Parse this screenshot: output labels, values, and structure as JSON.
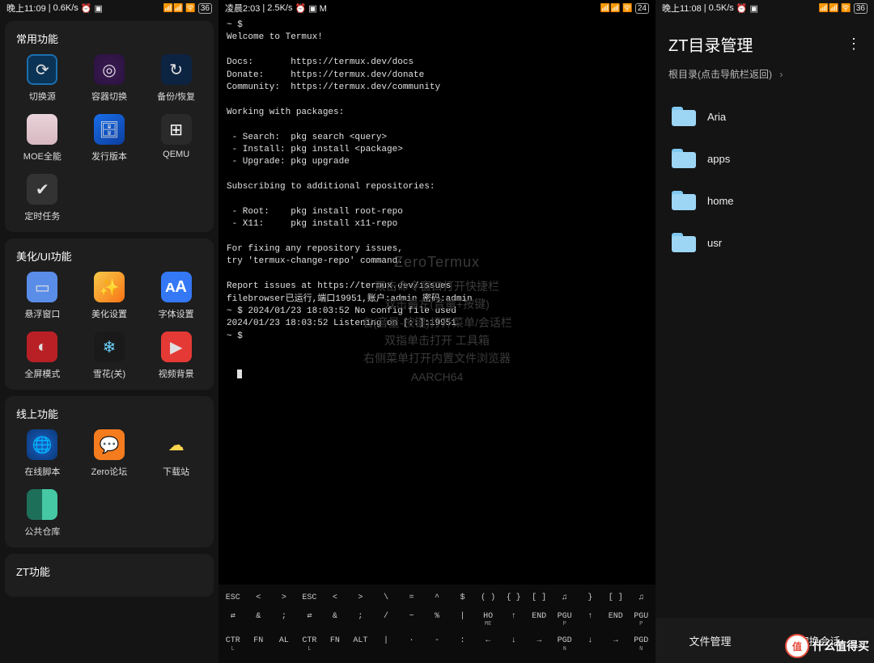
{
  "statusbars": {
    "left": {
      "time": "晚上11:09",
      "speed": "0.6K/s",
      "icons": "⏰ ▣",
      "net": "📶📶 🛜",
      "battery": "36"
    },
    "mid": {
      "time": "凌晨2:03",
      "speed": "2.5K/s",
      "icons": "⏰ ▣ M",
      "net": "📶📶 🛜",
      "battery": "24"
    },
    "right": {
      "time": "晚上11:08",
      "speed": "0.5K/s",
      "icons": "⏰ ▣",
      "net": "📶📶 🛜",
      "battery": "36"
    }
  },
  "sidebar": {
    "sections": [
      {
        "title": "常用功能",
        "items": [
          {
            "name": "switch-source",
            "label": "切换源",
            "bg": "bg-globe",
            "glyph": "⟳"
          },
          {
            "name": "container-switch",
            "label": "容器切换",
            "bg": "bg-purple",
            "glyph": "◎"
          },
          {
            "name": "backup-restore",
            "label": "备份/恢复",
            "bg": "bg-darkblue",
            "glyph": "↻"
          },
          {
            "name": "moe",
            "label": "MOE全能",
            "bg": "bg-avatar",
            "glyph": ""
          },
          {
            "name": "distro",
            "label": "发行版本",
            "bg": "bg-blue3d",
            "glyph": "🗄"
          },
          {
            "name": "qemu",
            "label": "QEMU",
            "bg": "bg-win",
            "glyph": "⊞"
          },
          {
            "name": "cron",
            "label": "定时任务",
            "bg": "bg-gray",
            "glyph": "✔"
          }
        ]
      },
      {
        "title": "美化/UI功能",
        "items": [
          {
            "name": "float-window",
            "label": "悬浮窗口",
            "bg": "bg-tab",
            "glyph": "▭"
          },
          {
            "name": "beautify",
            "label": "美化设置",
            "bg": "bg-rainbow",
            "glyph": "✨"
          },
          {
            "name": "font",
            "label": "字体设置",
            "bg": "bg-bluetext",
            "glyph": "ᴀA"
          },
          {
            "name": "fullscreen",
            "label": "全屏模式",
            "bg": "bg-red",
            "glyph": "◐"
          },
          {
            "name": "snow",
            "label": "雪花(关)",
            "bg": "bg-snow",
            "glyph": "❄"
          },
          {
            "name": "video-bg",
            "label": "视频背景",
            "bg": "bg-video",
            "glyph": "▶"
          }
        ]
      },
      {
        "title": "线上功能",
        "items": [
          {
            "name": "online-scripts",
            "label": "在线脚本",
            "bg": "bg-globe2",
            "glyph": "🌐"
          },
          {
            "name": "zero-forum",
            "label": "Zero论坛",
            "bg": "bg-orange",
            "glyph": "💬"
          },
          {
            "name": "downloads",
            "label": "下载站",
            "bg": "bg-cloud",
            "glyph": "☁"
          },
          {
            "name": "public-repo",
            "label": "公共仓库",
            "bg": "bg-ring",
            "glyph": ""
          }
        ]
      },
      {
        "title": "ZT功能",
        "items": []
      }
    ]
  },
  "terminal": {
    "prompt_top": "~ $ ",
    "welcome": "Welcome to Termux!",
    "rows": [
      "",
      "Docs:       https://termux.dev/docs",
      "Donate:     https://termux.dev/donate",
      "Community:  https://termux.dev/community",
      "",
      "Working with packages:",
      "",
      " - Search:  pkg search <query>",
      " - Install: pkg install <package>",
      " - Upgrade: pkg upgrade",
      "",
      "Subscribing to additional repositories:",
      "",
      " - Root:    pkg install root-repo",
      " - X11:     pkg install x11-repo",
      "",
      "For fixing any repository issues,",
      "try 'termux-change-repo' command.",
      "",
      "Report issues at https://termux.dev/issues",
      "filebrowser已运行,端口19951,账户:admin 密码:admin",
      "~ $ 2024/01/23 18:03:52 No config file used",
      "2024/01/23 18:03:52 Listening on [::]:19951",
      "~ $ "
    ],
    "hints": {
      "brand": "ZeroTermux",
      "lines": [
        "双击命令窗口打开快捷栏",
        "双击最左(音量+按键)",
        "右(音量-按键)打开菜单/会话栏",
        "双指单击打开 工具箱",
        "右侧菜单打开内置文件浏览器",
        "AARCH64"
      ]
    },
    "keyboard": {
      "row1": [
        "ESC",
        "<",
        ">",
        "ESC",
        "<",
        ">",
        "\\",
        "=",
        "^",
        "$",
        "( )",
        "{ }",
        "[ ]",
        "♫",
        "}",
        "[ ]",
        "♫"
      ],
      "row2": [
        "⇄",
        "&",
        ";",
        "⇄",
        "&",
        ";",
        "/",
        "~",
        "%",
        "|",
        "HO\nME",
        "↑",
        "END",
        "PGU\nP",
        "↑",
        "END",
        "PGU\nP"
      ],
      "row3": [
        "CTR\nL",
        "FN",
        "AL",
        "CTR\nL",
        "FN",
        "ALT",
        "|",
        "·",
        "-",
        ":",
        "←",
        "↓",
        "→",
        "PGD\nN",
        "↓",
        "→",
        "PGD\nN"
      ]
    }
  },
  "fileManager": {
    "title": "ZT目录管理",
    "breadcrumb": "根目录(点击导航栏返回)",
    "entries": [
      {
        "name": "Aria"
      },
      {
        "name": "apps"
      },
      {
        "name": "home"
      },
      {
        "name": "usr"
      }
    ],
    "footer": {
      "left": "文件管理",
      "right": "切换会话"
    }
  },
  "watermark": {
    "badge": "值",
    "text": "什么值得买"
  }
}
